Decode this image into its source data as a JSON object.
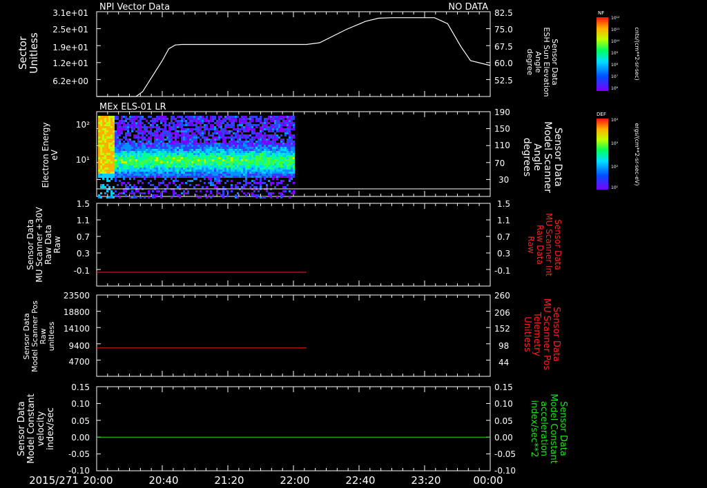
{
  "colors": {
    "axis": "#ffffff",
    "red": "#ff2020",
    "green": "#20e020"
  },
  "panel1": {
    "title": "NPI Vector Data",
    "status": "NO DATA",
    "left_label": [
      "Sector",
      "Unitless"
    ],
    "right_label": [
      "Sensor Data",
      "ESH Sun Elevation",
      "Angle",
      "degree"
    ],
    "left_ticks": [
      "3.1e+01",
      "2.5e+01",
      "1.9e+01",
      "1.2e+01",
      "6.2e+00"
    ],
    "right_ticks": [
      "82.5",
      "75.0",
      "67.5",
      "60.0",
      "52.5"
    ]
  },
  "panel2": {
    "title": "MEx ELS-01 LR",
    "left_label": [
      "Electron Energy",
      "eV"
    ],
    "right_label": [
      "Sensor Data",
      "Model Scanner",
      "Angle",
      "degrees"
    ],
    "left_ticks": [
      "10²",
      "10¹"
    ],
    "right_ticks": [
      "190",
      "150",
      "110",
      "70",
      "30"
    ]
  },
  "panel3": {
    "left_label": [
      "Sensor Data",
      "MU Scanner +30V",
      "Raw Data",
      "Raw"
    ],
    "right_label": [
      "Sensor Data",
      "MU Scanner Int",
      "Raw Data",
      "Raw"
    ],
    "left_ticks": [
      "1.5",
      "1.1",
      "0.7",
      "0.3",
      "-0.1"
    ],
    "right_ticks": [
      "1.5",
      "1.1",
      "0.7",
      "0.3",
      "-0.1"
    ]
  },
  "panel4": {
    "left_label": [
      "Sensor Data",
      "Model Scanner Pos",
      "Raw",
      "unitless"
    ],
    "right_label": [
      "Sensor Data",
      "MU Scanner Pos",
      "Telemetry",
      "Unitless"
    ],
    "left_ticks": [
      "23500",
      "18800",
      "14100",
      "9400",
      "4700"
    ],
    "right_ticks": [
      "260",
      "206",
      "152",
      "98",
      "44"
    ]
  },
  "panel5": {
    "left_label": [
      "Sensor Data",
      "Model Constant",
      "velocity",
      "index/sec"
    ],
    "right_label": [
      "Sensor Data",
      "Model Constant",
      "acceleration",
      "index/sec**2"
    ],
    "left_ticks": [
      "0.15",
      "0.10",
      "0.05",
      "0.00",
      "-0.05",
      "-0.10"
    ],
    "right_ticks": [
      "0.15",
      "0.10",
      "0.05",
      "0.00",
      "-0.05",
      "-0.10"
    ]
  },
  "colorbar1": {
    "title": "NF",
    "unit": "cnts/(cm**2-sr-sec)",
    "ticks": [
      "10¹²",
      "10¹¹",
      "10¹⁰",
      "10⁹",
      "10⁸",
      "10⁷",
      "10⁶"
    ]
  },
  "colorbar2": {
    "title": "DEF",
    "unit": "ergs/(cm**2-sr-sec-eV)",
    "ticks": [
      "10⁴",
      "10³",
      "10²",
      "10¹"
    ]
  },
  "time_axis": {
    "date": "2015/271",
    "labels": [
      "20:00",
      "20:40",
      "21:20",
      "22:00",
      "22:40",
      "23:20",
      "00:00"
    ]
  },
  "chart_data": [
    {
      "type": "line",
      "title": "NPI Vector Data",
      "ylabel": "Sensor Data ESH Sun Elevation Angle degree",
      "ylim": [
        47.0,
        82.5
      ],
      "x_unit": "hours after 2015/271 20:00",
      "x": [
        0.0,
        0.6,
        0.7,
        1.0,
        1.1,
        1.2,
        1.3,
        1.5,
        1.8,
        2.5,
        2.9,
        3.0,
        3.2,
        3.4,
        3.8,
        4.1,
        4.3,
        4.5,
        4.9,
        5.15,
        5.35,
        5.55,
        5.7,
        6.0
      ],
      "series": [
        {
          "values": [
            47.0,
            47.0,
            49.0,
            62.0,
            67.0,
            68.6,
            68.8,
            68.8,
            68.8,
            68.8,
            68.8,
            68.8,
            68.8,
            69.5,
            75.0,
            78.5,
            79.8,
            80.0,
            80.0,
            80.0,
            77.5,
            68.0,
            62.0,
            60.0
          ]
        }
      ]
    },
    {
      "type": "heatmap",
      "title": "MEx ELS-01 LR",
      "ylabel": "Electron Energy eV",
      "yscale": "log",
      "ylim": [
        1.5,
        180
      ],
      "x_range": [
        0.0,
        3.0
      ],
      "colorbar": "DEF ergs/(cm**2-sr-sec-eV)"
    },
    {
      "type": "line",
      "ylabel": "Sensor Data MU Scanner +30V Raw Data Raw",
      "ylim": [
        -0.3,
        1.5
      ],
      "x": [
        0.0,
        3.2
      ],
      "series": [
        {
          "values": [
            0.0,
            0.0
          ]
        }
      ]
    },
    {
      "type": "line",
      "ylabel": "Sensor Data Model Scanner Pos Raw unitless",
      "ylim": [
        0,
        23500
      ],
      "x": [
        0.0,
        3.2
      ],
      "series": [
        {
          "values": [
            8200,
            8200
          ]
        }
      ]
    },
    {
      "type": "line",
      "ylabel": "Sensor Data Model Constant velocity index/sec",
      "ylim": [
        -0.1,
        0.15
      ],
      "x": [
        0.0,
        6.0
      ],
      "series": [
        {
          "values": [
            0.0,
            0.0
          ]
        }
      ]
    }
  ]
}
